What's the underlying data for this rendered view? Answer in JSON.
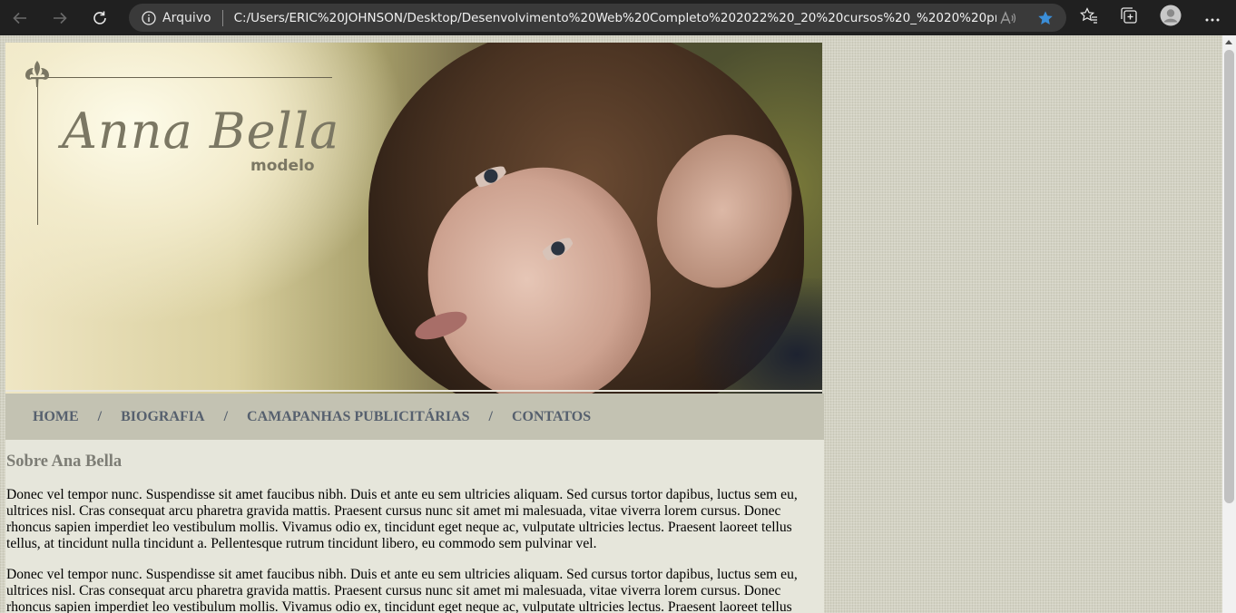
{
  "browser": {
    "address_scheme": "Arquivo",
    "address_url": "C:/Users/ERIC%20JOHNSON/Desktop/Desenvolvimento%20Web%20Completo%202022%20_20%20cursos%20_%2020%20projetos/Pr...",
    "icons": {
      "back": "back-arrow-icon",
      "forward": "forward-arrow-icon",
      "refresh": "refresh-icon",
      "info": "info-icon",
      "read_aloud": "read-aloud-icon",
      "favorite": "star-filled-icon",
      "favorites_list": "favorites-icon",
      "collections": "collections-icon",
      "profile": "profile-avatar-icon",
      "menu": "more-dots-icon"
    },
    "accent_color": "#3b8ed8"
  },
  "site": {
    "logo": {
      "name": "Anna Bella",
      "role": "modelo"
    },
    "menu": {
      "items": [
        "HOME",
        "BIOGRAFIA",
        "CAMAPANHAS PUBLICITÁRIAS",
        "CONTATOS"
      ],
      "separator": "/"
    },
    "content": {
      "title": "Sobre Ana Bella",
      "paragraphs": [
        "Donec vel tempor nunc. Suspendisse sit amet faucibus nibh. Duis et ante eu sem ultricies aliquam. Sed cursus tortor dapibus, luctus sem eu, ultrices nisl. Cras consequat arcu pharetra gravida mattis. Praesent cursus nunc sit amet mi malesuada, vitae viverra lorem cursus. Donec rhoncus sapien imperdiet leo vestibulum mollis. Vivamus odio ex, tincidunt eget neque ac, vulputate ultricies lectus. Praesent laoreet tellus tellus, at tincidunt nulla tincidunt a. Pellentesque rutrum tincidunt libero, eu commodo sem pulvinar vel.",
        "Donec vel tempor nunc. Suspendisse sit amet faucibus nibh. Duis et ante eu sem ultricies aliquam. Sed cursus tortor dapibus, luctus sem eu, ultrices nisl. Cras consequat arcu pharetra gravida mattis. Praesent cursus nunc sit amet mi malesuada, vitae viverra lorem cursus. Donec rhoncus sapien imperdiet leo vestibulum mollis. Vivamus odio ex, tincidunt eget neque ac, vulputate ultricies lectus. Praesent laoreet tellus"
      ]
    },
    "colors": {
      "menu_bar": "#c3c2b2",
      "menu_text": "#56606e",
      "content_bg": "#e6e6db",
      "page_bg": "#d3d2c3"
    }
  }
}
